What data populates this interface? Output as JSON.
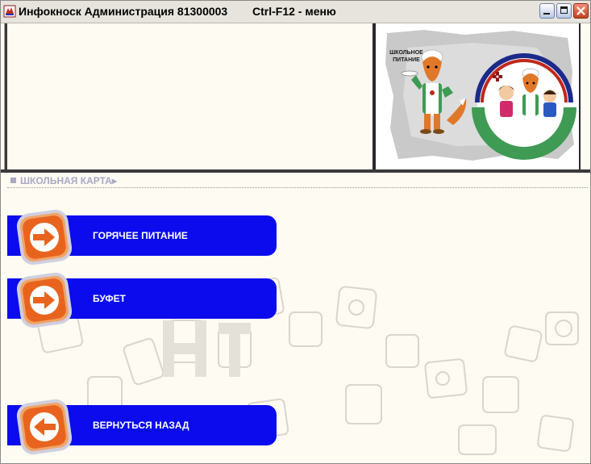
{
  "window": {
    "title": "Инфокноск Администрация 81300003",
    "hint": "Ctrl-F12 - меню"
  },
  "section": {
    "title": "ШКОЛЬНАЯ КАРТА▸"
  },
  "logo": {
    "left_caption_line1": "ШКОЛЬНОЕ",
    "left_caption_line2": "ПИТАНИЕ",
    "ring_text": "ШКОЛЬНОЕ ПИТАНИЕ"
  },
  "menu": {
    "hot_meals_label": "ГОРЯЧЕЕ ПИТАНИЕ",
    "buffet_label": "БУФЕТ",
    "back_label": "ВЕРНУТЬСЯ НАЗАД"
  },
  "colors": {
    "button_blue": "#0b0bee",
    "badge_orange": "#e8641e",
    "background": "#fdfbf2",
    "section_title": "#a9a9c4"
  },
  "icons": {
    "forward": "arrow-right-icon",
    "back": "arrow-left-icon"
  }
}
